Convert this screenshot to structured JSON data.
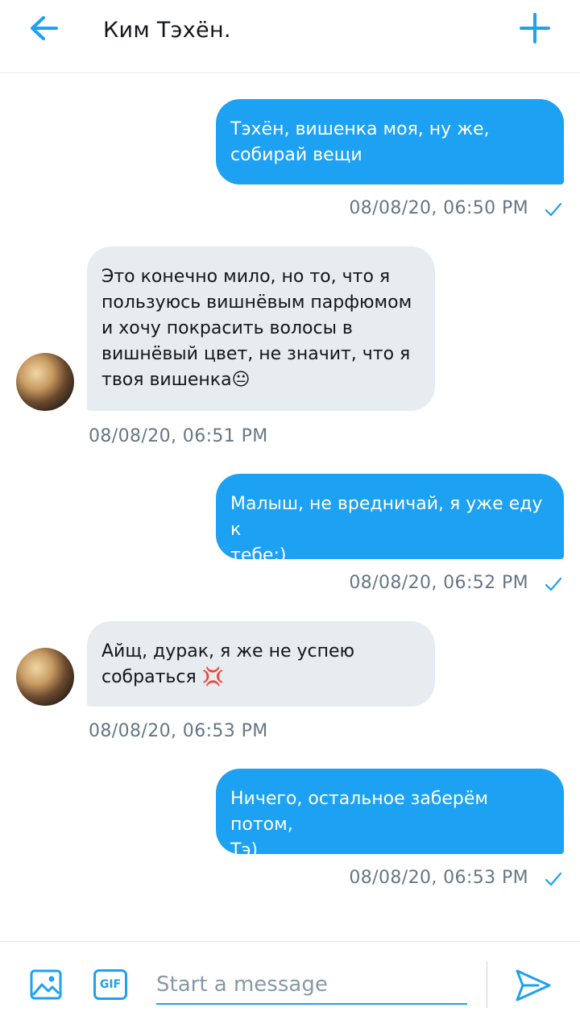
{
  "header": {
    "title": "Ким Тэхён.",
    "back_icon": "arrow-left-icon",
    "new_icon": "plus-icon"
  },
  "messages": [
    {
      "direction": "out",
      "text": "Тэхён, вишенка моя, ну же,\nсобирай вещи",
      "time": "08/08/20, 06:50 PM",
      "read": true
    },
    {
      "direction": "in",
      "text": "Это конечно мило, но то, что я\nпользуюсь вишнёвым парфюмом\nи хочу покрасить волосы в\nвишнёвый цвет, не значит, что я\nтвоя вишенка😐",
      "time": "08/08/20, 06:51 PM"
    },
    {
      "direction": "out",
      "text": "Малыш, не вредничай, я уже еду к\nтебе;)",
      "time": "08/08/20, 06:52 PM",
      "read": true
    },
    {
      "direction": "in",
      "text": "Айщ, дурак, я же не успею\nсобраться 💢",
      "time": "08/08/20, 06:53 PM"
    },
    {
      "direction": "out",
      "text": "Ничего, остальное заберём потом,\nТэ)",
      "time": "08/08/20, 06:53 PM",
      "read": true
    }
  ],
  "composer": {
    "placeholder": "Start a message",
    "gif_label": "GIF",
    "image_icon": "image-icon",
    "send_icon": "send-icon"
  },
  "colors": {
    "accent": "#1da1f2",
    "incoming_bubble": "#e6ecf0",
    "timestamp": "#657786"
  }
}
